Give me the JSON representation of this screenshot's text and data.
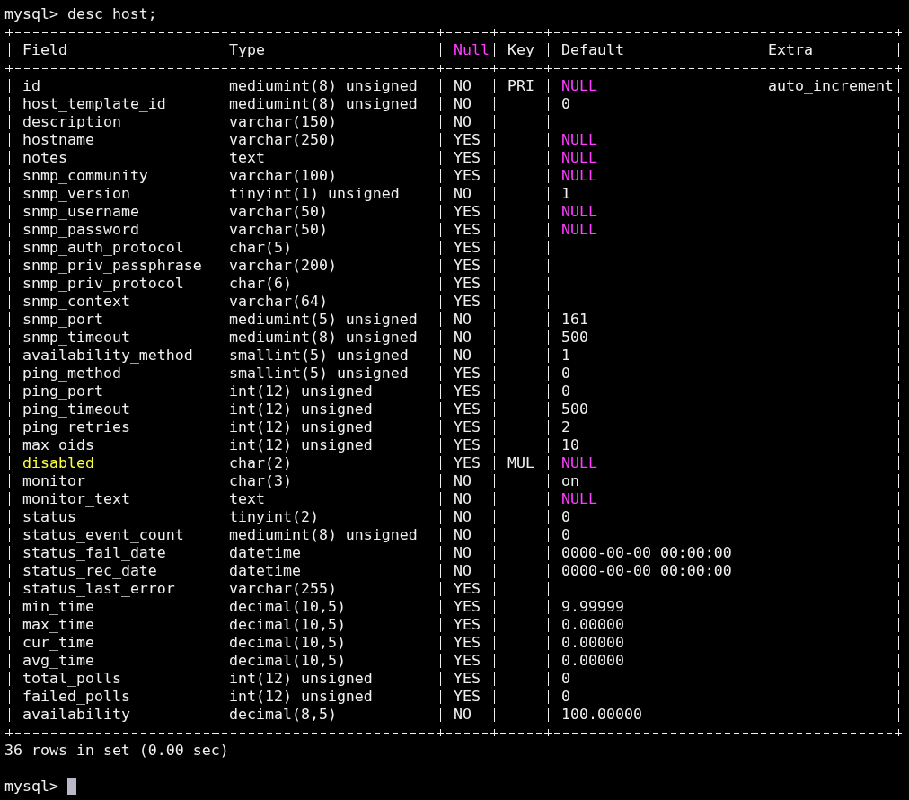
{
  "command": "mysql> desc host;",
  "columns": [
    {
      "label": "Field",
      "highlighted": false
    },
    {
      "label": "Type",
      "highlighted": false
    },
    {
      "label": "Null",
      "highlighted": true
    },
    {
      "label": "Key",
      "highlighted": false
    },
    {
      "label": "Default",
      "highlighted": false
    },
    {
      "label": "Extra",
      "highlighted": false
    }
  ],
  "rows": [
    {
      "field": "id",
      "type": "mediumint(8) unsigned",
      "null": "NO",
      "key": "PRI",
      "default": "NULL",
      "default_is_null": true,
      "extra": "auto_increment",
      "highlighted": false
    },
    {
      "field": "host_template_id",
      "type": "mediumint(8) unsigned",
      "null": "NO",
      "default": "0",
      "default_is_null": false,
      "highlighted": false
    },
    {
      "field": "description",
      "type": "varchar(150)",
      "null": "NO",
      "highlighted": false
    },
    {
      "field": "hostname",
      "type": "varchar(250)",
      "null": "YES",
      "default": "NULL",
      "default_is_null": true,
      "highlighted": false
    },
    {
      "field": "notes",
      "type": "text",
      "null": "YES",
      "default": "NULL",
      "default_is_null": true,
      "highlighted": false
    },
    {
      "field": "snmp_community",
      "type": "varchar(100)",
      "null": "YES",
      "default": "NULL",
      "default_is_null": true,
      "highlighted": false
    },
    {
      "field": "snmp_version",
      "type": "tinyint(1) unsigned",
      "null": "NO",
      "default": "1",
      "default_is_null": false,
      "highlighted": false
    },
    {
      "field": "snmp_username",
      "type": "varchar(50)",
      "null": "YES",
      "default": "NULL",
      "default_is_null": true,
      "highlighted": false
    },
    {
      "field": "snmp_password",
      "type": "varchar(50)",
      "null": "YES",
      "default": "NULL",
      "default_is_null": true,
      "highlighted": false
    },
    {
      "field": "snmp_auth_protocol",
      "type": "char(5)",
      "null": "YES",
      "highlighted": false
    },
    {
      "field": "snmp_priv_passphrase",
      "type": "varchar(200)",
      "null": "YES",
      "highlighted": false
    },
    {
      "field": "snmp_priv_protocol",
      "type": "char(6)",
      "null": "YES",
      "highlighted": false
    },
    {
      "field": "snmp_context",
      "type": "varchar(64)",
      "null": "YES",
      "highlighted": false
    },
    {
      "field": "snmp_port",
      "type": "mediumint(5) unsigned",
      "null": "NO",
      "default": "161",
      "default_is_null": false,
      "highlighted": false
    },
    {
      "field": "snmp_timeout",
      "type": "mediumint(8) unsigned",
      "null": "NO",
      "default": "500",
      "default_is_null": false,
      "highlighted": false
    },
    {
      "field": "availability_method",
      "type": "smallint(5) unsigned",
      "null": "NO",
      "default": "1",
      "default_is_null": false,
      "highlighted": false
    },
    {
      "field": "ping_method",
      "type": "smallint(5) unsigned",
      "null": "YES",
      "default": "0",
      "default_is_null": false,
      "highlighted": false
    },
    {
      "field": "ping_port",
      "type": "int(12) unsigned",
      "null": "YES",
      "default": "0",
      "default_is_null": false,
      "highlighted": false
    },
    {
      "field": "ping_timeout",
      "type": "int(12) unsigned",
      "null": "YES",
      "default": "500",
      "default_is_null": false,
      "highlighted": false
    },
    {
      "field": "ping_retries",
      "type": "int(12) unsigned",
      "null": "YES",
      "default": "2",
      "default_is_null": false,
      "highlighted": false
    },
    {
      "field": "max_oids",
      "type": "int(12) unsigned",
      "null": "YES",
      "default": "10",
      "default_is_null": false,
      "highlighted": false
    },
    {
      "field": "disabled",
      "type": "char(2)",
      "null": "YES",
      "key": "MUL",
      "default": "NULL",
      "default_is_null": true,
      "highlighted": true
    },
    {
      "field": "monitor",
      "type": "char(3)",
      "null": "NO",
      "default": "on",
      "default_is_null": false,
      "highlighted": false
    },
    {
      "field": "monitor_text",
      "type": "text",
      "null": "NO",
      "default": "NULL",
      "default_is_null": true,
      "highlighted": false
    },
    {
      "field": "status",
      "type": "tinyint(2)",
      "null": "NO",
      "default": "0",
      "default_is_null": false,
      "highlighted": false
    },
    {
      "field": "status_event_count",
      "type": "mediumint(8) unsigned",
      "null": "NO",
      "default": "0",
      "default_is_null": false,
      "highlighted": false
    },
    {
      "field": "status_fail_date",
      "type": "datetime",
      "null": "NO",
      "default": "0000-00-00 00:00:00",
      "default_is_null": false,
      "highlighted": false
    },
    {
      "field": "status_rec_date",
      "type": "datetime",
      "null": "NO",
      "default": "0000-00-00 00:00:00",
      "default_is_null": false,
      "highlighted": false
    },
    {
      "field": "status_last_error",
      "type": "varchar(255)",
      "null": "YES",
      "highlighted": false
    },
    {
      "field": "min_time",
      "type": "decimal(10,5)",
      "null": "YES",
      "default": "9.99999",
      "default_is_null": false,
      "highlighted": false
    },
    {
      "field": "max_time",
      "type": "decimal(10,5)",
      "null": "YES",
      "default": "0.00000",
      "default_is_null": false,
      "highlighted": false
    },
    {
      "field": "cur_time",
      "type": "decimal(10,5)",
      "null": "YES",
      "default": "0.00000",
      "default_is_null": false,
      "highlighted": false
    },
    {
      "field": "avg_time",
      "type": "decimal(10,5)",
      "null": "YES",
      "default": "0.00000",
      "default_is_null": false,
      "highlighted": false
    },
    {
      "field": "total_polls",
      "type": "int(12) unsigned",
      "null": "YES",
      "default": "0",
      "default_is_null": false,
      "highlighted": false
    },
    {
      "field": "failed_polls",
      "type": "int(12) unsigned",
      "null": "YES",
      "default": "0",
      "default_is_null": false,
      "highlighted": false
    },
    {
      "field": "availability",
      "type": "decimal(8,5)",
      "null": "NO",
      "default": "100.00000",
      "default_is_null": false,
      "highlighted": false
    }
  ],
  "result": "36 rows in set (0.00 sec)",
  "prompt": "mysql>"
}
